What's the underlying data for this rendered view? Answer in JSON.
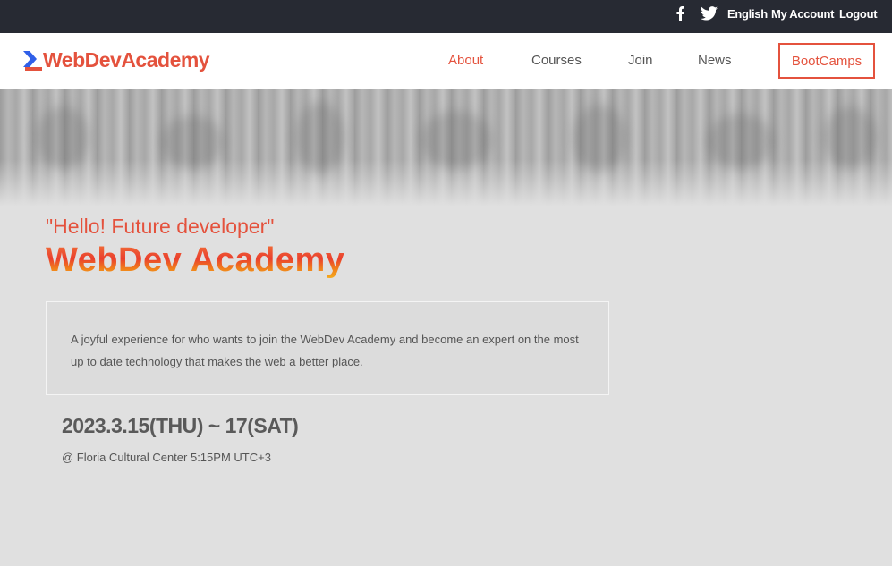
{
  "topbar": {
    "icons": [
      "facebook-icon",
      "twitter-icon"
    ],
    "language": "English",
    "my_account": "My Account",
    "logout": "Logout"
  },
  "header": {
    "logo_text": "WebDevAcademy",
    "nav": {
      "about": "About",
      "courses": "Courses",
      "join": "Join",
      "news": "News",
      "bootcamps": "BootCamps"
    },
    "active_item": "About"
  },
  "hero": {
    "tagline": "\"Hello! Future developer\"",
    "title": "WebDev Academy",
    "description": "A joyful experience for who wants to join the WebDev Academy and become an expert on the most up to date technology that makes the web a better place.",
    "date": "2023.3.15(THU) ~ 17(SAT)",
    "location": "@ Floria Cultural Center 5:15PM UTC+3"
  },
  "colors": {
    "accent": "#e4523d",
    "topbar_bg": "#272a33",
    "page_bg": "#e0e0e0",
    "logo_mark": "#2f5fe8"
  }
}
